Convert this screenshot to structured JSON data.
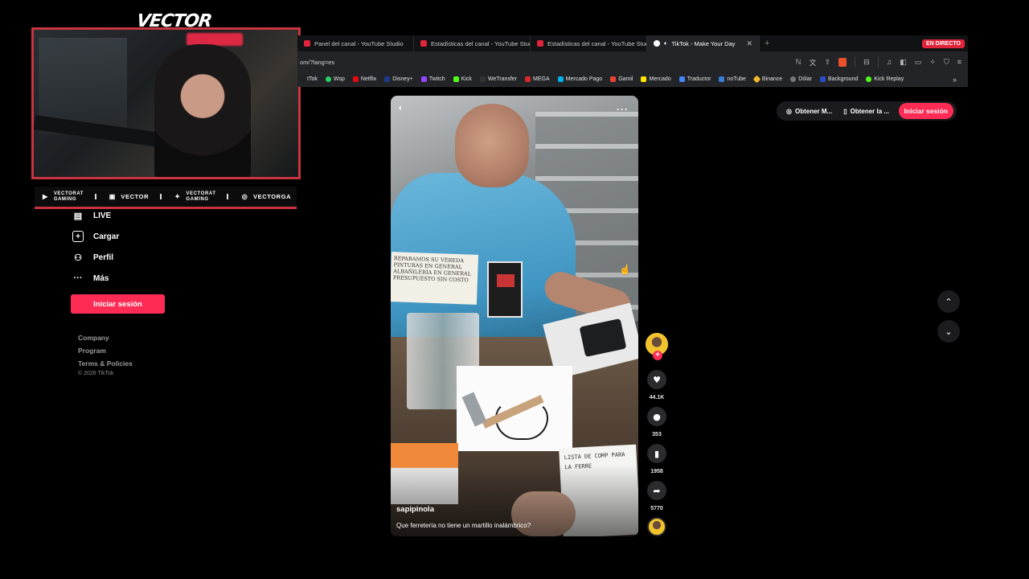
{
  "overlay": {
    "logo": "VECTOR",
    "socials": [
      {
        "icon": "youtube-icon",
        "line1": "VECTORAT",
        "line2": "GAMING"
      },
      {
        "icon": "twitch-icon",
        "label": "VECTOR"
      },
      {
        "icon": "twitter-icon",
        "line1": "VECTORAT",
        "line2": "GAMING"
      },
      {
        "icon": "instagram-icon",
        "label": "VECTORGA"
      }
    ]
  },
  "browser": {
    "tabs": [
      {
        "title": "Panel del canal - YouTube Studio",
        "active": false
      },
      {
        "title": "Estadísticas del canal - YouTube Studi",
        "active": false
      },
      {
        "title": "Estadísticas del canal - YouTube Studi",
        "active": false
      },
      {
        "title": "TikTok - Make Your Day",
        "active": true
      }
    ],
    "live_badge": "EN DIRECTO",
    "url": "om/?lang=es",
    "bookmarks": [
      {
        "label": "tTok",
        "color": "#222222"
      },
      {
        "label": "Wsp",
        "color": "#25d366"
      },
      {
        "label": "Netflix",
        "color": "#e50914"
      },
      {
        "label": "Disney+",
        "color": "#1d3a8a"
      },
      {
        "label": "Twitch",
        "color": "#9146ff"
      },
      {
        "label": "Kick",
        "color": "#53fc18"
      },
      {
        "label": "WeTransfer",
        "color": "#333333"
      },
      {
        "label": "MEGA",
        "color": "#d9272e"
      },
      {
        "label": "Mercado Pago",
        "color": "#00b1ea"
      },
      {
        "label": "Gamil",
        "color": "#ea4335"
      },
      {
        "label": "Mercado",
        "color": "#ffe600"
      },
      {
        "label": "Traductor",
        "color": "#4285f4"
      },
      {
        "label": "noTube",
        "color": "#3a7bd5"
      },
      {
        "label": "Binance",
        "color": "#f3ba2f"
      },
      {
        "label": "Dólar",
        "color": "#777777"
      },
      {
        "label": "Background",
        "color": "#2b4acb"
      },
      {
        "label": "Kick Replay",
        "color": "#53fc18"
      }
    ]
  },
  "sidebar": {
    "items": [
      {
        "label": "LIVE",
        "icon": "live-tv-icon"
      },
      {
        "label": "Cargar",
        "icon": "upload-plus-icon"
      },
      {
        "label": "Perfil",
        "icon": "profile-icon"
      },
      {
        "label": "Más",
        "icon": "more-dots-icon"
      }
    ],
    "login_label": "Iniciar sesión",
    "footer": [
      "Company",
      "Program",
      "Terms & Policies"
    ],
    "copyright": "© 2026 TikTok"
  },
  "topright": {
    "btn1": "Obtener M...",
    "btn2": "Obtener la ...",
    "login_label": "Iniciar sesión"
  },
  "video": {
    "author": "sapipinola",
    "caption": "Que ferretería no tiene un martillo inalámbrico?",
    "sign_text": "REPARAMOS SU VEREDA PINTURAS EN GENERAL ALBAÑILERÍA EN GENERAL PRESUPUESTO SIN COSTO",
    "note_text": "LISTA DE COMP PARA LA FERRE",
    "more_label": "···"
  },
  "actions": {
    "likes": "44.1K",
    "comments": "353",
    "saves": "1958",
    "shares": "5770"
  },
  "colors": {
    "accent": "#fe2c55",
    "overlay_border": "#c8343f"
  }
}
